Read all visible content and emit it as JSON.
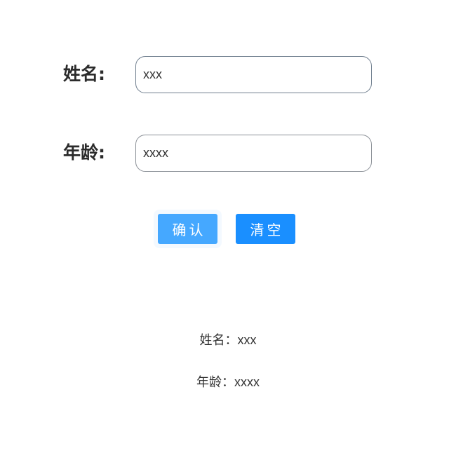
{
  "form": {
    "name": {
      "label": "姓名:",
      "value": "xxx"
    },
    "age": {
      "label": "年龄:",
      "value": "xxxx"
    }
  },
  "buttons": {
    "confirm_label": "确认",
    "clear_label": "清空"
  },
  "result": {
    "name_label": "姓名：",
    "name_value": "xxx",
    "age_label": "年龄：",
    "age_value": "xxxx"
  },
  "colors": {
    "confirm_button": "#45a8ff",
    "clear_button": "#1a8fff"
  }
}
